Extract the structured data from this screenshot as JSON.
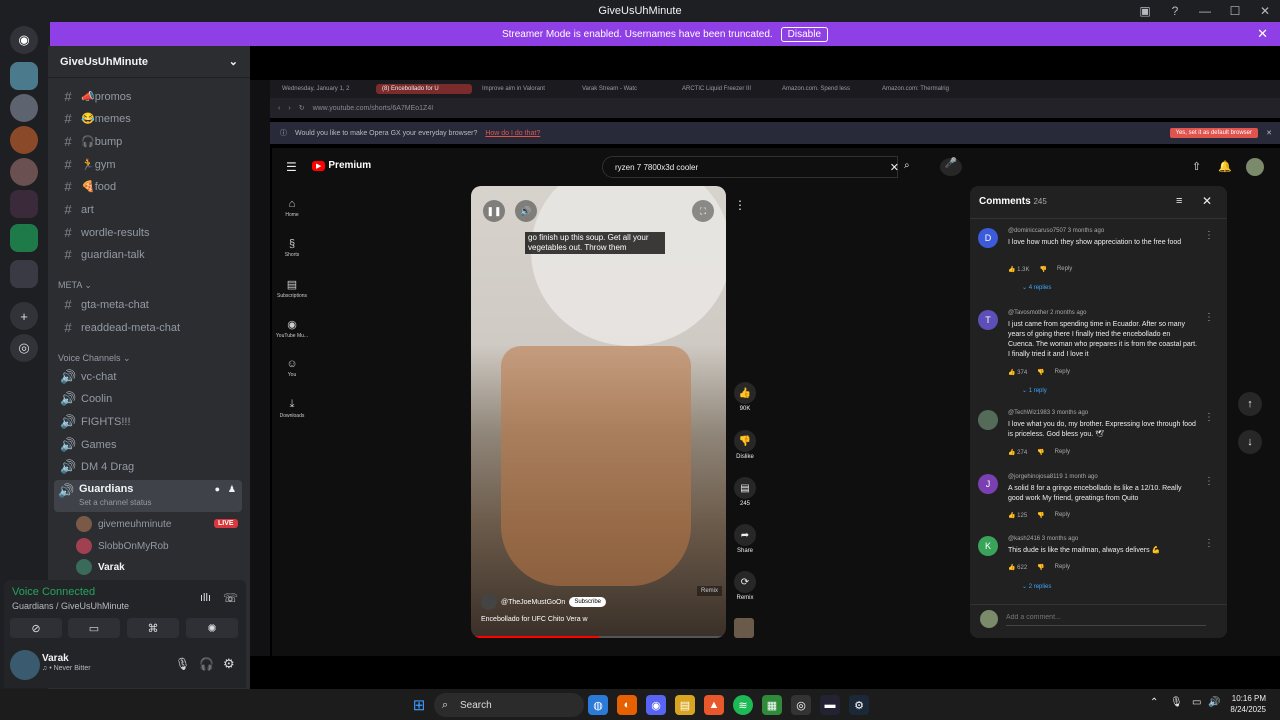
{
  "window": {
    "title": "GiveUsUhMinute"
  },
  "banner": {
    "text": "Streamer Mode is enabled. Usernames have been truncated.",
    "button": "Disable"
  },
  "server": {
    "name": "GiveUsUhMinute"
  },
  "channels": [
    {
      "emoji": "📣",
      "name": "promos"
    },
    {
      "emoji": "😂",
      "name": "memes"
    },
    {
      "emoji": "🎧",
      "name": "bump"
    },
    {
      "emoji": "🏃",
      "name": "gym"
    },
    {
      "emoji": "🍕",
      "name": "food"
    },
    {
      "emoji": "",
      "name": "art"
    },
    {
      "emoji": "",
      "name": "wordle-results"
    },
    {
      "emoji": "",
      "name": "guardian-talk"
    }
  ],
  "meta_category": "META",
  "meta_channels": [
    "gta-meta-chat",
    "readdead-meta-chat"
  ],
  "voice_category": "Voice Channels",
  "voice_channels": [
    "vc-chat",
    "Coolin",
    "FIGHTS!!!",
    "Games",
    "DM 4 Drag",
    "Guardians"
  ],
  "guardians_status": "Set a channel status",
  "voice_users": [
    "givemeuhminute",
    "SlobbOnMyRob",
    "Varak"
  ],
  "live_badge": "LIVE",
  "voice_panel": {
    "status": "Voice Connected",
    "location": "Guardians / GiveUsUhMinute"
  },
  "user_panel": {
    "name": "Varak",
    "status": "Never Bitter"
  },
  "browser": {
    "tabs": [
      "Wednesday, January 1, 2",
      "(8) Encebollado for U",
      "Improve aim in Valorant",
      "Varak Stream - Watc",
      "ARCTIC Liquid Freezer III",
      "Amazon.com. Spend less",
      "Amazon.com: Thermalrig"
    ],
    "url": "www.youtube.com/shorts/6A7MEo1Z4I",
    "default_prompt": "Would you like to make Opera GX your everyday browser?",
    "how_link": "How do I do that?",
    "set_default": "Yes, set it as default browser"
  },
  "youtube": {
    "logo": "Premium",
    "search": "ryzen 7 7800x3d cooler",
    "nav": [
      "Home",
      "Shorts",
      "Subscriptions",
      "YouTube Mu...",
      "You",
      "Downloads"
    ],
    "caption": "go finish up this soup. Get all your vegetables out. Throw them",
    "channel": "@TheJoeMustGoOn",
    "subscribe": "Subscribe",
    "video_title": "Encebollado for UFC Chito Vera w",
    "remix_badge": "Remix",
    "likes": "90K",
    "dislike": "Dislike",
    "comment_count": "245",
    "share": "Share",
    "remix": "Remix"
  },
  "comments": {
    "title": "Comments",
    "count": "245",
    "placeholder": "Add a comment...",
    "reply": "Reply",
    "items": [
      {
        "initial": "D",
        "color": "#3b5bdb",
        "user": "@dominiccaruso7507",
        "time": "3 months ago",
        "text": "I love how much they show appreciation to the free food",
        "likes": "1.3K",
        "replies": "4 replies"
      },
      {
        "initial": "T",
        "color": "#5c4fb8",
        "user": "@Tavosmother",
        "time": "2 months ago",
        "text": "I just came from spending time in Ecuador. After so many years of going there I finally tried the encebollado en Cuenca. The woman who prepares it is from the coastal part. I finally tried it and I love it",
        "likes": "374",
        "replies": "1 reply"
      },
      {
        "initial": "",
        "color": "#556b5a",
        "user": "@TechWiz1983",
        "time": "3 months ago",
        "text": "I love what you do, my brother. Expressing love through food is priceless. God bless you. 🕊",
        "likes": "274",
        "replies": ""
      },
      {
        "initial": "J",
        "color": "#7a3fb0",
        "user": "@jorgehinojosa8119",
        "time": "1 month ago",
        "text": "A solid 8 for a gringo encebollado its like a 12/10. Really good work My friend, greatings from Quito",
        "likes": "125",
        "replies": ""
      },
      {
        "initial": "K",
        "color": "#3aa35a",
        "user": "@kash2416",
        "time": "3 months ago",
        "text": "This dude is like the mailman, always delivers 💪",
        "likes": "622",
        "replies": "2 replies"
      }
    ]
  },
  "taskbar": {
    "search": "Search",
    "time": "10:16 PM",
    "date": "8/24/2025"
  }
}
